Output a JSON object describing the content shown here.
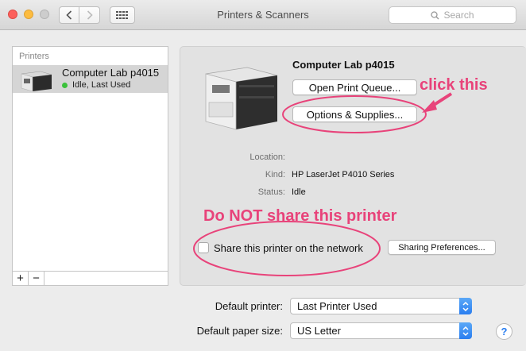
{
  "window": {
    "title": "Printers & Scanners",
    "search_placeholder": "Search"
  },
  "printer_list": {
    "header": "Printers",
    "items": [
      {
        "name": "Computer Lab p4015",
        "status": "Idle, Last Used"
      }
    ],
    "add_label": "+",
    "remove_label": "−"
  },
  "detail": {
    "printer_name": "Computer Lab p4015",
    "open_queue_label": "Open Print Queue...",
    "options_label": "Options & Supplies...",
    "fields": {
      "location_label": "Location:",
      "location_value": "",
      "kind_label": "Kind:",
      "kind_value": "HP LaserJet P4010 Series",
      "status_label": "Status:",
      "status_value": "Idle"
    },
    "share_label": "Share this printer on the network",
    "share_checked": false,
    "sharing_prefs_label": "Sharing Preferences..."
  },
  "defaults": {
    "default_printer_label": "Default printer:",
    "default_printer_value": "Last Printer Used",
    "paper_size_label": "Default paper size:",
    "paper_size_value": "US Letter"
  },
  "annotations": {
    "click_this": "click this",
    "do_not_share": "Do NOT share this printer",
    "color": "#e8437a"
  },
  "icons": {
    "back": "chevron-left-icon",
    "forward": "chevron-right-icon",
    "grid": "grid-icon",
    "search": "search-icon",
    "help": "help-icon"
  }
}
